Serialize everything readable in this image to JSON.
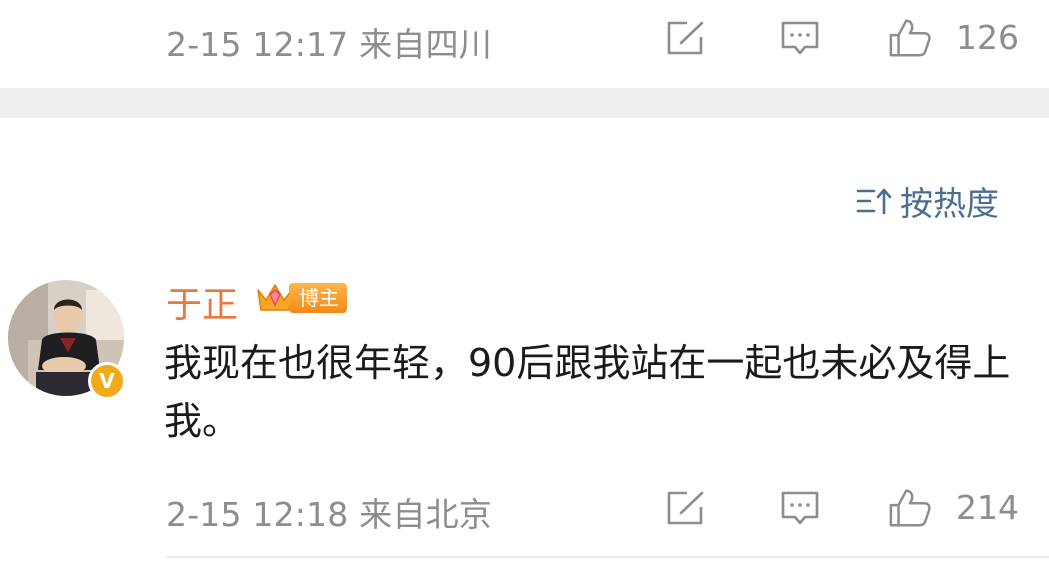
{
  "previous_comment": {
    "meta": "2-15 12:17  来自四川",
    "like_count": "126"
  },
  "sort": {
    "label": "按热度"
  },
  "comment": {
    "username": "于正",
    "badge": "博主",
    "text": "我现在也很年轻，90后跟我站在一起也未必及得上我。",
    "meta": "2-15 12:18  来自北京",
    "like_count": "214"
  },
  "icons": {
    "share": "share-icon",
    "comment": "comment-icon",
    "like": "thumbs-up-icon",
    "sort": "sort-icon",
    "crown": "crown-icon",
    "verified": "verified-v-icon"
  },
  "colors": {
    "username": "#e8793b",
    "meta_gray": "#8d8d8d",
    "sort_blue": "#4a6d92",
    "badge_orange": "#f28a1c",
    "verified_gold": "#f3aa1a"
  }
}
